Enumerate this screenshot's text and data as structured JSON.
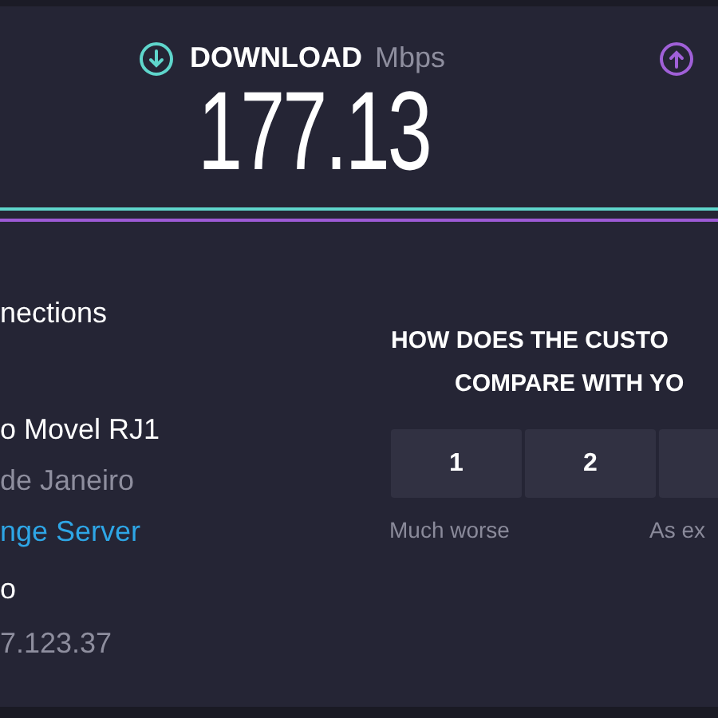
{
  "download": {
    "label": "DOWNLOAD",
    "unit": "Mbps",
    "value": "177.13"
  },
  "connection_info": [
    {
      "text": "nections",
      "kind": "heading"
    },
    {
      "text": "o Movel RJ1",
      "kind": "name"
    },
    {
      "text": "de Janeiro",
      "kind": "detail"
    },
    {
      "text": "nge Server",
      "kind": "link"
    },
    {
      "text": "o",
      "kind": "name"
    },
    {
      "text": "7.123.37",
      "kind": "detail"
    }
  ],
  "survey": {
    "question_lines": [
      "HOW DOES THE CUSTO",
      "COMPARE WITH YO"
    ],
    "ratings": [
      "1",
      "2"
    ],
    "scale_labels": [
      "Much worse",
      "As ex"
    ]
  }
}
